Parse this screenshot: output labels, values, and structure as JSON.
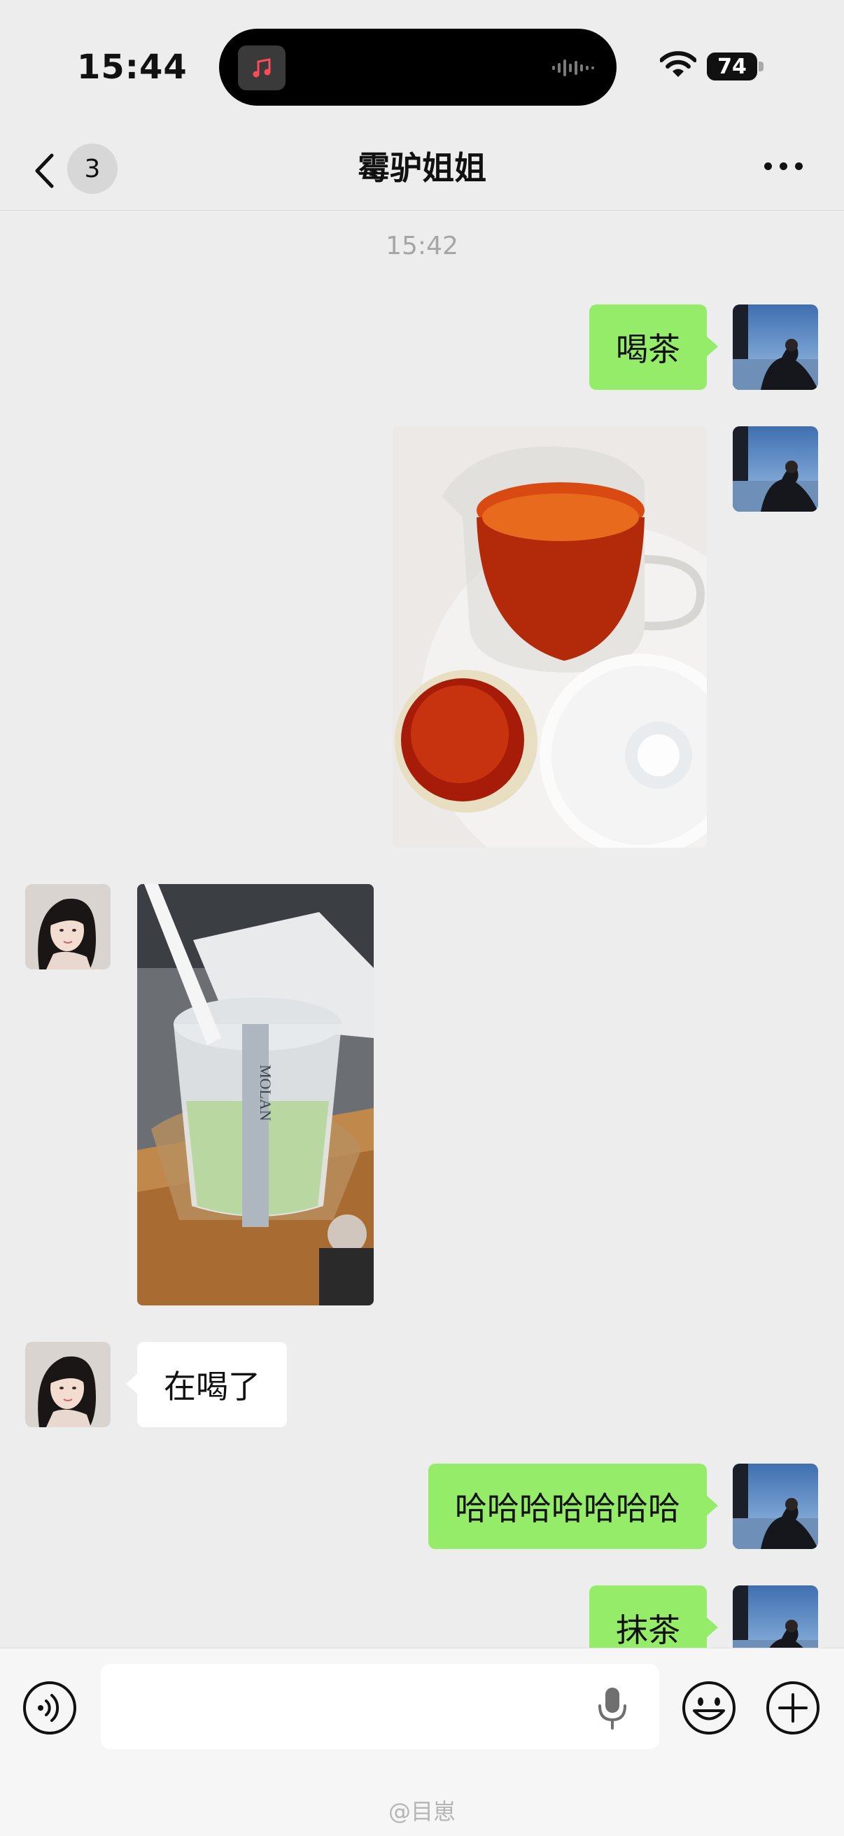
{
  "status_bar": {
    "time": "15:44",
    "battery_level": "74",
    "icons": [
      "music-app-icon",
      "audio-wave-icon",
      "wifi-icon",
      "battery-icon"
    ]
  },
  "header": {
    "unread_count": "3",
    "title": "霉驴姐姐",
    "icons": [
      "back-chevron-icon",
      "more-dots-icon"
    ]
  },
  "chat": {
    "timestamp": "15:42",
    "messages": [
      {
        "sender": "me",
        "type": "text",
        "text": "喝茶"
      },
      {
        "sender": "me",
        "type": "image",
        "image": "tea-pitcher-and-cups-photo"
      },
      {
        "sender": "contact",
        "type": "image",
        "image": "matcha-cup-photo"
      },
      {
        "sender": "contact",
        "type": "text",
        "text": "在喝了"
      },
      {
        "sender": "me",
        "type": "text",
        "text": "哈哈哈哈哈哈哈"
      },
      {
        "sender": "me",
        "type": "text",
        "text": "抹茶"
      }
    ],
    "photo_cup_label": "MOLAN"
  },
  "input_bar": {
    "placeholder": "",
    "icons": [
      "voice-mode-icon",
      "microphone-icon",
      "emoji-icon",
      "plus-icon"
    ]
  },
  "watermark": "@目崽",
  "colors": {
    "background": "#ededed",
    "my_bubble": "#95ec69",
    "their_bubble": "#ffffff",
    "timestamp": "#a6a6a6"
  }
}
